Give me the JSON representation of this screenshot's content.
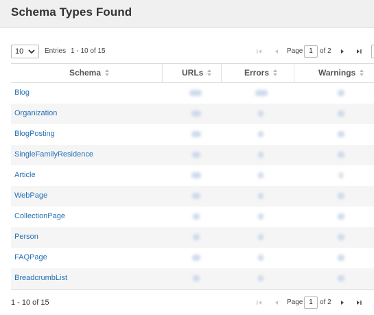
{
  "header": {
    "title": "Schema Types Found"
  },
  "pager": {
    "page_size": "10",
    "entries_label": "Entries",
    "range_top": "1 - 10 of 15",
    "range_bottom": "1 - 10 of 15",
    "page_label": "Page",
    "page_value": "1",
    "of_label": "of 2"
  },
  "table": {
    "columns": [
      "Schema",
      "URLs",
      "Errors",
      "Warnings"
    ],
    "rows": [
      {
        "schema": "Blog"
      },
      {
        "schema": "Organization"
      },
      {
        "schema": "BlogPosting"
      },
      {
        "schema": "SingleFamilyResidence"
      },
      {
        "schema": "Article"
      },
      {
        "schema": "WebPage"
      },
      {
        "schema": "CollectionPage"
      },
      {
        "schema": "Person"
      },
      {
        "schema": "FAQPage"
      },
      {
        "schema": "BreadcrumbList"
      }
    ]
  },
  "colors": {
    "link": "#2470b6",
    "header_bg": "#f0f0f0",
    "row_alt": "#f5f5f5"
  }
}
